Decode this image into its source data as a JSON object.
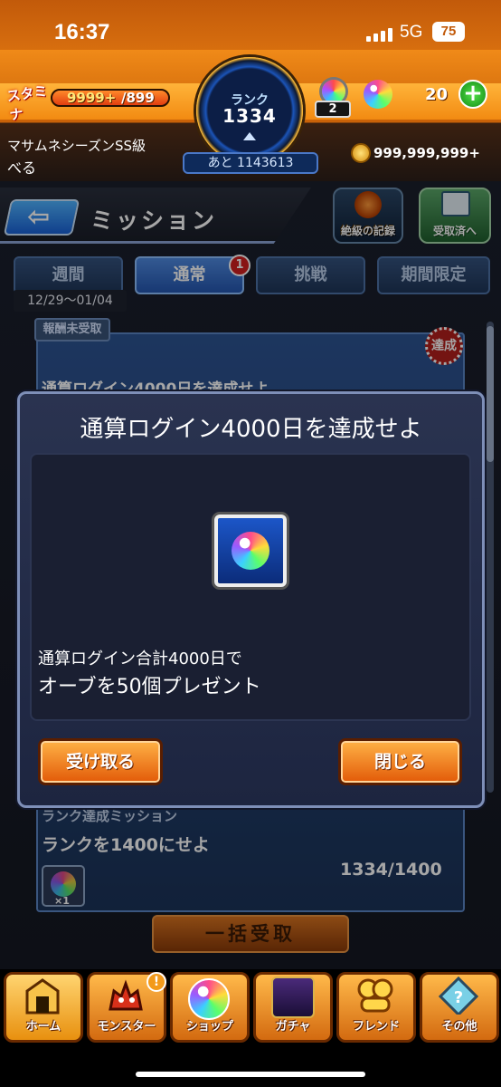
{
  "status_bar": {
    "time": "16:37",
    "network": "5G",
    "battery": "75"
  },
  "hud": {
    "stamina_icon_label": "スタミナ",
    "stamina_current": "9999+",
    "stamina_max": "/899",
    "stamina_fill_fraction": 1.0,
    "user_title": "マサムネシーズンSS級",
    "user_name": "べる",
    "rank_label": "ランク",
    "rank_value": "1334",
    "rank_next": "あと 1143613",
    "orb_item_count": "2",
    "orb_balance": "20",
    "coins": "999,999,999+"
  },
  "header": {
    "title": "ミッション",
    "records_button": "絶級の記録",
    "received_button": "受取済へ"
  },
  "tabs": [
    {
      "label": "週間",
      "active": false
    },
    {
      "label": "通常",
      "active": true,
      "badge": "1"
    },
    {
      "label": "挑戦",
      "active": false
    },
    {
      "label": "期間限定",
      "active": false
    }
  ],
  "date_range": "12/29〜01/04",
  "mission_list": {
    "unclaimed_label": "報酬未受取",
    "achieved_seal": "達成",
    "item1_title": "通算ログイン4000日を達成せよ",
    "item2_category": "ランク達成ミッション",
    "item2_title": "ランクを1400にせよ",
    "item2_progress": "1334/1400",
    "item2_reward_qty": "×1",
    "bulk_claim": "一括受取"
  },
  "dialog": {
    "title": "通算ログイン4000日を達成せよ",
    "reward_icon": "rainbow-orb-icon",
    "description_line1": "通算ログイン合計4000日で",
    "description_line2": "オーブを50個プレゼント",
    "receive_button": "受け取る",
    "close_button": "閉じる"
  },
  "bottom_nav": [
    {
      "label": "ホーム",
      "icon": "home-icon"
    },
    {
      "label": "モンスター",
      "icon": "monster-icon",
      "badge": "!"
    },
    {
      "label": "ショップ",
      "icon": "orb-shop-icon"
    },
    {
      "label": "ガチャ",
      "icon": "gacha-character-icon"
    },
    {
      "label": "フレンド",
      "icon": "friends-icon"
    },
    {
      "label": "その他",
      "icon": "other-icon"
    }
  ],
  "colors": {
    "accent_orange": "#f08a18",
    "dialog_bg": "#2a3350",
    "tab_active": "#2456b0"
  }
}
